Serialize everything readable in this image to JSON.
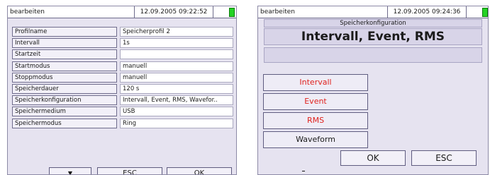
{
  "left": {
    "titlebar": {
      "mode": "bearbeiten",
      "datetime": "12.09.2005 09:22:52"
    },
    "rows": [
      {
        "label": "Profilname",
        "value": "Speicherprofil 2"
      },
      {
        "label": "Intervall",
        "value": "1s"
      },
      {
        "label": "Startzeit",
        "value": ""
      },
      {
        "label": "Startmodus",
        "value": "manuell"
      },
      {
        "label": "Stoppmodus",
        "value": "manuell"
      },
      {
        "label": "Speicherdauer",
        "value": "120 s"
      },
      {
        "label": "Speicherkonfiguration",
        "value": "Intervall, Event, RMS, Wavefor.."
      },
      {
        "label": "Speichermedium",
        "value": "USB"
      },
      {
        "label": "Speichermodus",
        "value": "Ring"
      }
    ],
    "buttons": {
      "down": "▼",
      "esc": "ESC",
      "ok": "OK"
    }
  },
  "right": {
    "titlebar": {
      "mode": "bearbeiten",
      "datetime": "12.09.2005 09:24:36"
    },
    "subheader": "Speicherkonfiguration",
    "heading": "Intervall, Event, RMS",
    "options": [
      "Intervall",
      "Event",
      "RMS",
      "Waveform"
    ],
    "buttons": {
      "ok": "OK",
      "esc": "ESC"
    }
  },
  "colors": {
    "screen_bg": "#e6e3f0",
    "active_option_text": "#e0221e",
    "battery": "#24d324"
  }
}
